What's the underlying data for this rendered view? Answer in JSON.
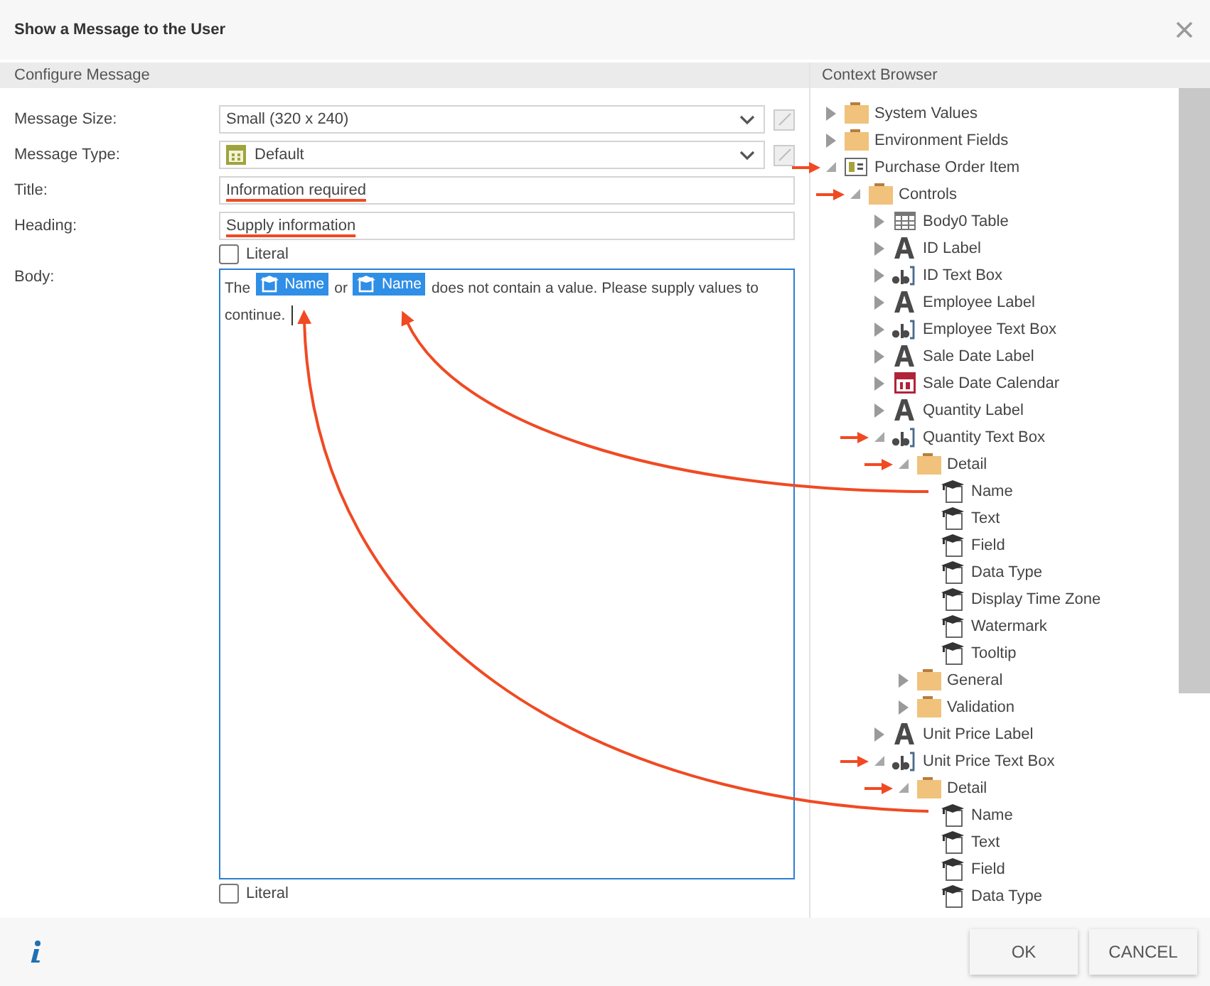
{
  "dialog": {
    "title": "Show a Message to the User"
  },
  "configure": {
    "header": "Configure Message",
    "fields": [
      {
        "kind": "select",
        "label": "Message Size:",
        "value": "Small (320 x 240)"
      },
      {
        "kind": "type-select",
        "label": "Message Type:",
        "value": "Default"
      },
      {
        "kind": "text",
        "label": "Title:",
        "value": "Information required",
        "underlined": true
      },
      {
        "kind": "text",
        "label": "Heading:",
        "value": "Supply information",
        "underlined": true
      },
      {
        "kind": "checkbox",
        "label": "Literal",
        "checked": false
      },
      {
        "kind": "body",
        "label": "Body:",
        "parts": [
          {
            "kind": "text",
            "text": "The"
          },
          {
            "kind": "token",
            "text": "Name"
          },
          {
            "kind": "text",
            "text": "or"
          },
          {
            "kind": "token",
            "text": "Name"
          },
          {
            "kind": "text",
            "text": "does not contain a value. Please supply values to"
          },
          {
            "kind": "text",
            "text": "continue."
          }
        ]
      },
      {
        "kind": "checkbox",
        "label": "Literal",
        "checked": false
      }
    ]
  },
  "context_browser": {
    "header": "Context Browser",
    "tree": [
      {
        "label": "System Values",
        "kind": "folder",
        "expanded": false,
        "marked": false
      },
      {
        "label": "Environment Fields",
        "kind": "folder",
        "expanded": false,
        "marked": false
      },
      {
        "label": "Purchase Order Item",
        "kind": "record",
        "expanded": true,
        "marked": true,
        "children": [
          {
            "label": "Controls",
            "kind": "folder",
            "expanded": true,
            "marked": true,
            "children": [
              {
                "label": "Body0 Table",
                "kind": "table",
                "expanded": false,
                "marked": false
              },
              {
                "label": "ID Label",
                "kind": "label",
                "expanded": false,
                "marked": false
              },
              {
                "label": "ID Text Box",
                "kind": "textbox",
                "expanded": false,
                "marked": false
              },
              {
                "label": "Employee Label",
                "kind": "label",
                "expanded": false,
                "marked": false
              },
              {
                "label": "Employee Text Box",
                "kind": "textbox",
                "expanded": false,
                "marked": false
              },
              {
                "label": "Sale Date Label",
                "kind": "label",
                "expanded": false,
                "marked": false
              },
              {
                "label": "Sale Date Calendar",
                "kind": "calendar",
                "expanded": false,
                "marked": false
              },
              {
                "label": "Quantity Label",
                "kind": "label",
                "expanded": false,
                "marked": false
              },
              {
                "label": "Quantity Text Box",
                "kind": "textbox",
                "expanded": true,
                "marked": true,
                "children": [
                  {
                    "label": "Detail",
                    "kind": "folder",
                    "expanded": true,
                    "marked": true,
                    "children": [
                      {
                        "label": "Name",
                        "kind": "property"
                      },
                      {
                        "label": "Text",
                        "kind": "property"
                      },
                      {
                        "label": "Field",
                        "kind": "property"
                      },
                      {
                        "label": "Data Type",
                        "kind": "property"
                      },
                      {
                        "label": "Display Time Zone",
                        "kind": "property"
                      },
                      {
                        "label": "Watermark",
                        "kind": "property"
                      },
                      {
                        "label": "Tooltip",
                        "kind": "property"
                      }
                    ]
                  },
                  {
                    "label": "General",
                    "kind": "folder",
                    "expanded": false,
                    "marked": false
                  },
                  {
                    "label": "Validation",
                    "kind": "folder",
                    "expanded": false,
                    "marked": false
                  }
                ]
              },
              {
                "label": "Unit Price Label",
                "kind": "label",
                "expanded": false,
                "marked": false
              },
              {
                "label": "Unit Price Text Box",
                "kind": "textbox",
                "expanded": true,
                "marked": true,
                "children": [
                  {
                    "label": "Detail",
                    "kind": "folder",
                    "expanded": true,
                    "marked": true,
                    "children": [
                      {
                        "label": "Name",
                        "kind": "property"
                      },
                      {
                        "label": "Text",
                        "kind": "property"
                      },
                      {
                        "label": "Field",
                        "kind": "property"
                      },
                      {
                        "label": "Data Type",
                        "kind": "property"
                      }
                    ]
                  }
                ]
              }
            ]
          }
        ]
      }
    ]
  },
  "buttons": [
    "OK",
    "CANCEL"
  ]
}
